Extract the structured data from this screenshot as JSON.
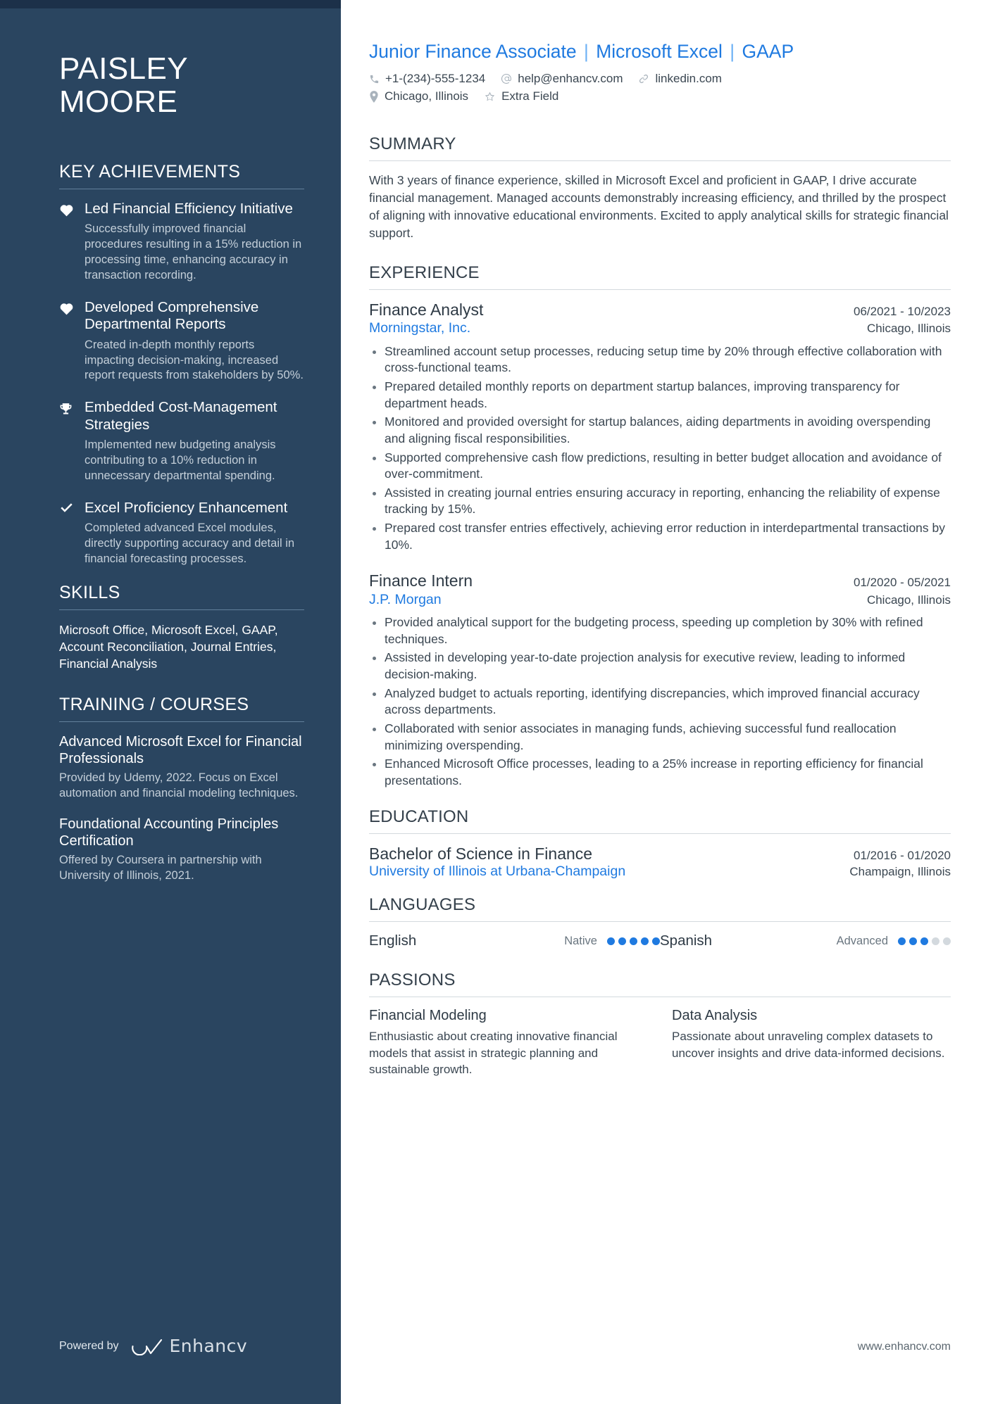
{
  "sidebar": {
    "name_line1": "PAISLEY",
    "name_line2": "MOORE",
    "achievements_heading": "KEY ACHIEVEMENTS",
    "achievements": [
      {
        "icon": "heart-icon",
        "title": "Led Financial Efficiency Initiative",
        "desc": "Successfully improved financial procedures resulting in a 15% reduction in processing time, enhancing accuracy in transaction recording."
      },
      {
        "icon": "heart-icon",
        "title": "Developed Comprehensive Departmental Reports",
        "desc": "Created in-depth monthly reports impacting decision-making, increased report requests from stakeholders by 50%."
      },
      {
        "icon": "trophy-icon",
        "title": "Embedded Cost-Management Strategies",
        "desc": "Implemented new budgeting analysis contributing to a 10% reduction in unnecessary departmental spending."
      },
      {
        "icon": "check-icon",
        "title": "Excel Proficiency Enhancement",
        "desc": "Completed advanced Excel modules, directly supporting accuracy and detail in financial forecasting processes."
      }
    ],
    "skills_heading": "SKILLS",
    "skills_text": "Microsoft Office, Microsoft Excel, GAAP, Account Reconciliation, Journal Entries, Financial Analysis",
    "training_heading": "TRAINING / COURSES",
    "courses": [
      {
        "title": "Advanced Microsoft Excel for Financial Professionals",
        "desc": "Provided by Udemy, 2022. Focus on Excel automation and financial modeling techniques."
      },
      {
        "title": "Foundational Accounting Principles Certification",
        "desc": "Offered by Coursera in partnership with University of Illinois, 2021."
      }
    ],
    "powered_by_label": "Powered by",
    "brand_name": "Enhancv"
  },
  "header": {
    "headline_parts": [
      "Junior Finance Associate",
      "Microsoft Excel",
      "GAAP"
    ],
    "contacts_row1": [
      {
        "icon": "phone-icon",
        "text": "+1-(234)-555-1234"
      },
      {
        "icon": "email-icon",
        "text": "help@enhancv.com"
      },
      {
        "icon": "link-icon",
        "text": "linkedin.com"
      }
    ],
    "contacts_row2": [
      {
        "icon": "location-icon",
        "text": "Chicago, Illinois"
      },
      {
        "icon": "star-icon",
        "text": "Extra Field"
      }
    ]
  },
  "summary": {
    "heading": "SUMMARY",
    "text": "With 3 years of finance experience, skilled in Microsoft Excel and proficient in GAAP, I drive accurate financial management. Managed accounts demonstrably increasing efficiency, and thrilled by the prospect of aligning with innovative educational environments. Excited to apply analytical skills for strategic financial support."
  },
  "experience": {
    "heading": "EXPERIENCE",
    "jobs": [
      {
        "title": "Finance Analyst",
        "date": "06/2021 - 10/2023",
        "company": "Morningstar, Inc.",
        "location": "Chicago, Illinois",
        "bullets": [
          "Streamlined account setup processes, reducing setup time by 20% through effective collaboration with cross-functional teams.",
          "Prepared detailed monthly reports on department startup balances, improving transparency for department heads.",
          "Monitored and provided oversight for startup balances, aiding departments in avoiding overspending and aligning fiscal responsibilities.",
          "Supported comprehensive cash flow predictions, resulting in better budget allocation and avoidance of over-commitment.",
          "Assisted in creating journal entries ensuring accuracy in reporting, enhancing the reliability of expense tracking by 15%.",
          "Prepared cost transfer entries effectively, achieving error reduction in interdepartmental transactions by 10%."
        ]
      },
      {
        "title": "Finance Intern",
        "date": "01/2020 - 05/2021",
        "company": "J.P. Morgan",
        "location": "Chicago, Illinois",
        "bullets": [
          "Provided analytical support for the budgeting process, speeding up completion by 30% with refined techniques.",
          "Assisted in developing year-to-date projection analysis for executive review, leading to informed decision-making.",
          "Analyzed budget to actuals reporting, identifying discrepancies, which improved financial accuracy across departments.",
          "Collaborated with senior associates in managing funds, achieving successful fund reallocation minimizing overspending.",
          "Enhanced Microsoft Office processes, leading to a 25% increase in reporting efficiency for financial presentations."
        ]
      }
    ]
  },
  "education": {
    "heading": "EDUCATION",
    "entries": [
      {
        "degree": "Bachelor of Science in Finance",
        "date": "01/2016 - 01/2020",
        "school": "University of Illinois at Urbana-Champaign",
        "location": "Champaign, Illinois"
      }
    ]
  },
  "languages": {
    "heading": "LANGUAGES",
    "items": [
      {
        "name": "English",
        "level": "Native",
        "filled": 5,
        "total": 5
      },
      {
        "name": "Spanish",
        "level": "Advanced",
        "filled": 3,
        "total": 5
      }
    ]
  },
  "passions": {
    "heading": "PASSIONS",
    "items": [
      {
        "title": "Financial Modeling",
        "desc": "Enthusiastic about creating innovative financial models that assist in strategic planning and sustainable growth."
      },
      {
        "title": "Data Analysis",
        "desc": "Passionate about unraveling complex datasets to uncover insights and drive data-informed decisions."
      }
    ]
  },
  "footer": {
    "website": "www.enhancv.com"
  },
  "colors": {
    "sidebar_bg": "#2a4560",
    "accent_blue": "#1f7ae0",
    "body_text": "#3b4752"
  }
}
